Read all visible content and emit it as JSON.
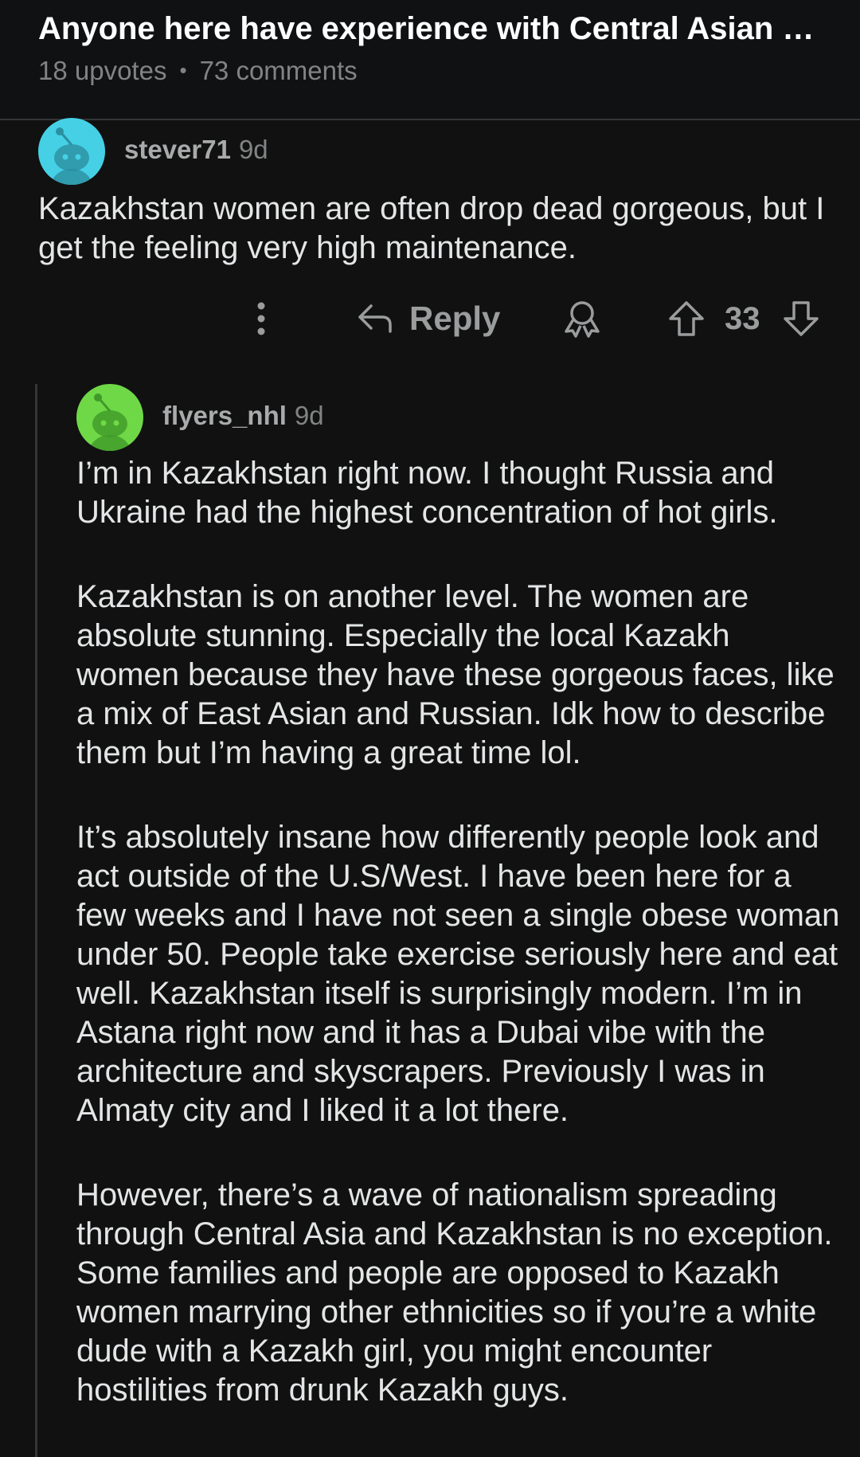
{
  "post": {
    "title": "Anyone here have experience with Central Asian w...",
    "upvotes": "18 upvotes",
    "separator": "•",
    "comments": "73 comments"
  },
  "comment1": {
    "username": "stever71",
    "age": "9d",
    "text": "Kazakhstan women are often drop dead gorgeous, but I get the feeling very high maintenance.",
    "actions": {
      "reply_label": "Reply",
      "score": "33"
    }
  },
  "comment2": {
    "username": "flyers_nhl",
    "age": "9d",
    "paragraphs": [
      "I’m in Kazakhstan right now. I thought Russia and Ukraine had the highest concentration of hot girls.",
      "Kazakhstan is on another level. The women are absolute stunning. Especially the local Kazakh women because they have these gorgeous faces, like a mix of East Asian and Russian. Idk how to describe them but I’m having a great time lol.",
      "It’s absolutely insane how differently people look and act outside of the U.S/West. I have been here for a few weeks and I have not seen a single obese woman under 50. People take exercise seriously here and eat well. Kazakhstan itself is surprisingly modern. I’m in Astana right now and it has a Dubai vibe with the architecture and skyscrapers. Previously I was in Almaty city and I liked it a lot there.",
      "However, there’s a wave of nationalism spreading through Central Asia and Kazakhstan is no exception. Some families and people are opposed to Kazakh women marrying other ethnicities so if you’re a white dude with a Kazakh girl, you might encounter hostilities from drunk Kazakh guys."
    ]
  },
  "icons": {
    "more": "more-options-icon",
    "reply": "reply-arrow-icon",
    "award": "award-icon",
    "upvote": "upvote-arrow-icon",
    "downvote": "downvote-arrow-icon",
    "avatar": "snoo-avatar-icon"
  },
  "colors": {
    "background": "#111111",
    "header_bg": "#0f1113",
    "text": "#e3e5e6",
    "muted": "#818384",
    "avatar1": "#45d0e6",
    "avatar2": "#6fd847"
  }
}
